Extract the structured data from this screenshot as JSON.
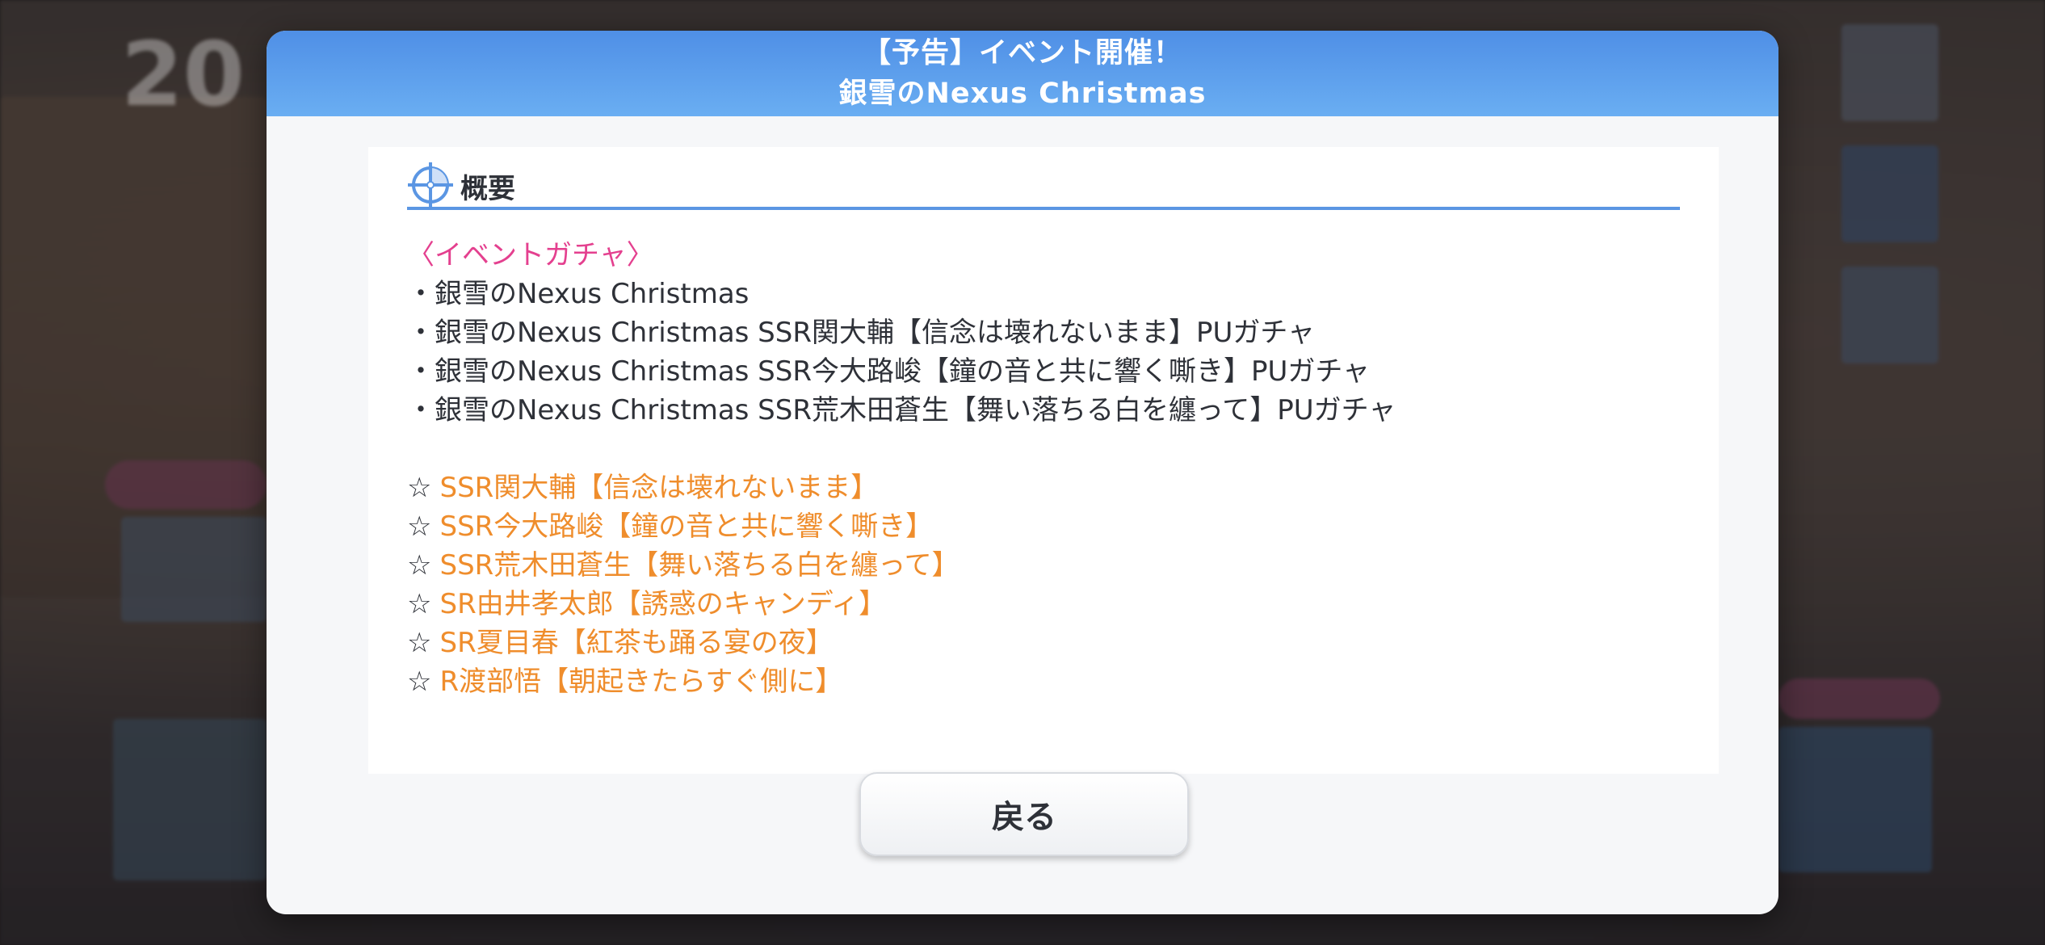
{
  "background": {
    "clock_text": "20"
  },
  "modal": {
    "title_line1": "【予告】イベント開催！",
    "title_line2": "銀雪のNexus Christmas",
    "section": {
      "icon": "crosshair-icon",
      "title": "概要"
    },
    "gacha_heading": "〈イベントガチャ〉",
    "gacha_items": [
      "・銀雪のNexus Christmas",
      "・銀雪のNexus Christmas SSR関大輔【信念は壊れないまま】PUガチャ",
      "・銀雪のNexus Christmas SSR今大路峻【鐘の音と共に響く嘶き】PUガチャ",
      "・銀雪のNexus Christmas SSR荒木田蒼生【舞い落ちる白を纏って】PUガチャ"
    ],
    "star_symbol": "☆",
    "cards": [
      "SSR関大輔【信念は壊れないまま】",
      "SSR今大路峻【鐘の音と共に響く嘶き】",
      "SSR荒木田蒼生【舞い落ちる白を纏って】",
      "SR由井孝太郎【誘惑のキャンディ】",
      "SR夏目春【紅茶も踊る宴の夜】",
      "R渡部悟【朝起きたらすぐ側に】"
    ],
    "back_label": "戻る"
  },
  "colors": {
    "header_top": "#4f8fe6",
    "header_bottom": "#6aaef2",
    "accent_line": "#5b96e3",
    "gacha_heading": "#e4408f",
    "card_names": "#ef8d2c",
    "body_text": "#2e3138"
  }
}
